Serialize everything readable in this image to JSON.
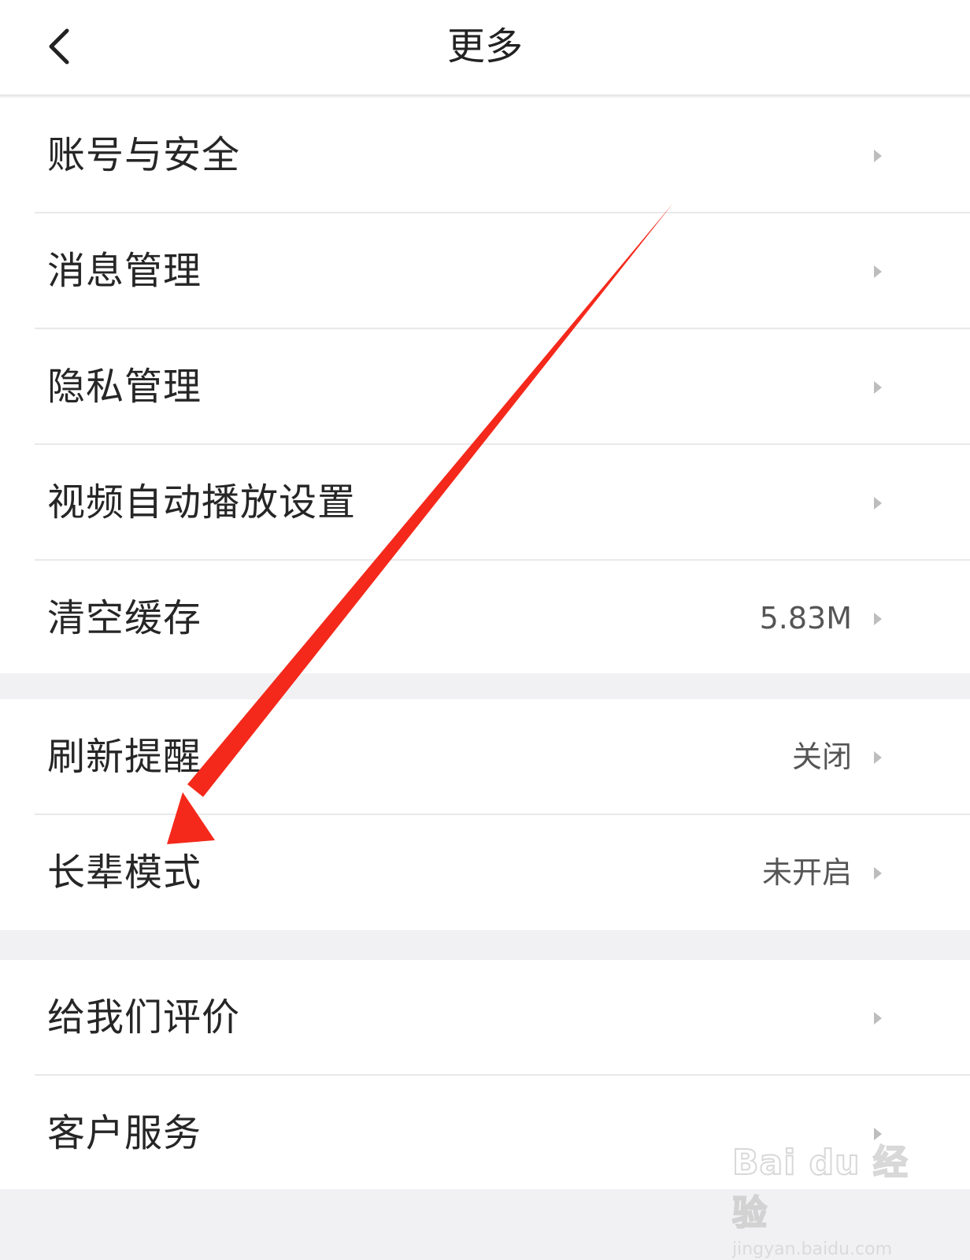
{
  "header": {
    "title": "更多",
    "back_icon": "chevron-left-icon"
  },
  "groups": [
    {
      "items": [
        {
          "label": "账号与安全",
          "value": ""
        },
        {
          "label": "消息管理",
          "value": ""
        },
        {
          "label": "隐私管理",
          "value": ""
        },
        {
          "label": "视频自动播放设置",
          "value": ""
        },
        {
          "label": "清空缓存",
          "value": "5.83M"
        }
      ]
    },
    {
      "items": [
        {
          "label": "刷新提醒",
          "value": "关闭"
        },
        {
          "label": "长辈模式",
          "value": "未开启"
        }
      ]
    },
    {
      "items": [
        {
          "label": "给我们评价",
          "value": ""
        },
        {
          "label": "客户服务",
          "value": ""
        }
      ]
    }
  ],
  "annotation": {
    "arrow_color": "#f4291b"
  },
  "watermark": {
    "logo": "Bai du 经验",
    "url": "jingyan.baidu.com"
  }
}
